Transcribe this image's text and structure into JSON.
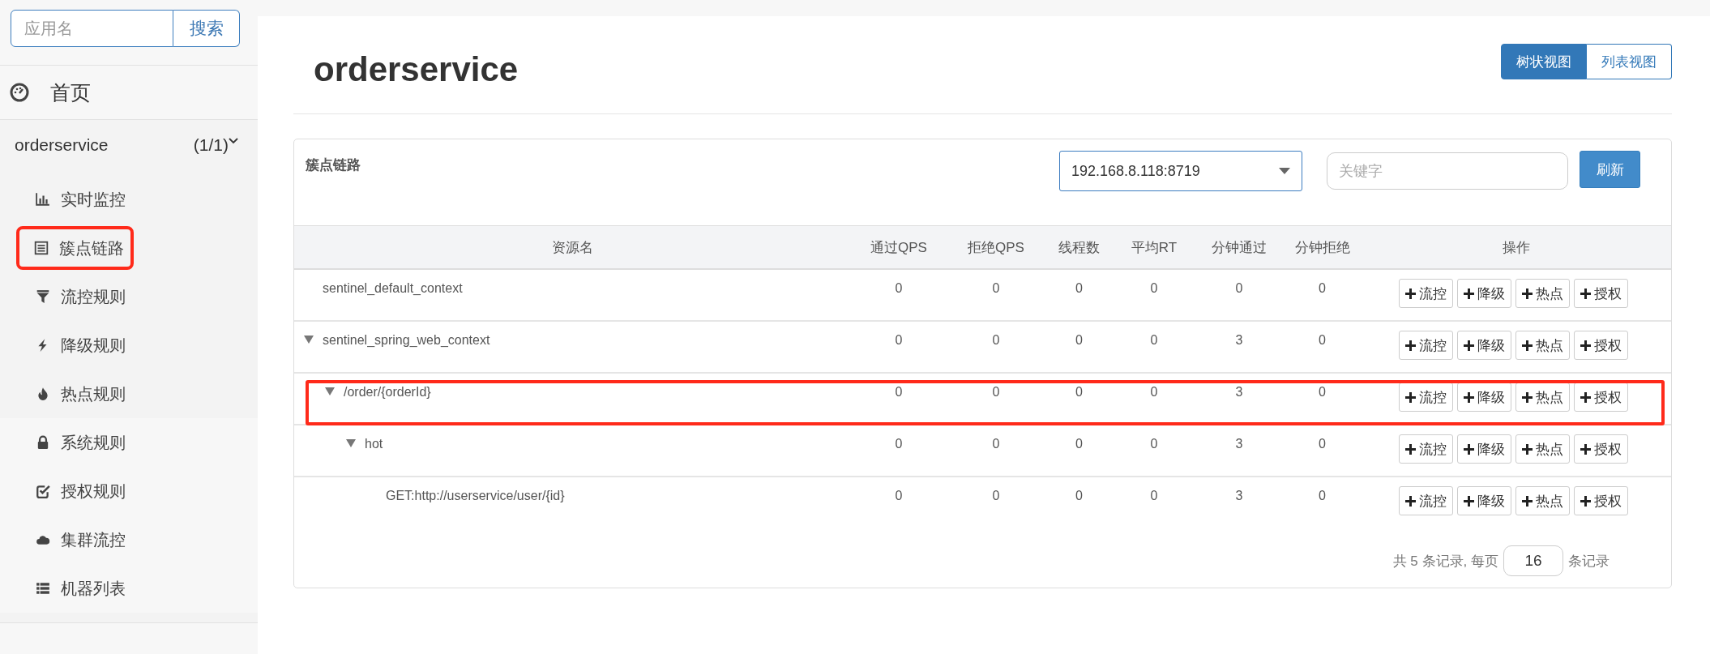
{
  "sidebar": {
    "search": {
      "placeholder": "应用名",
      "button": "搜索"
    },
    "home": {
      "label": "首页"
    },
    "app": {
      "name": "orderservice",
      "count": "(1/1)",
      "expanded": true,
      "items": [
        {
          "label": "实时监控",
          "highlighted": false
        },
        {
          "label": "簇点链路",
          "highlighted": true
        },
        {
          "label": "流控规则",
          "highlighted": false
        },
        {
          "label": "降级规则",
          "highlighted": false
        },
        {
          "label": "热点规则",
          "highlighted": false
        },
        {
          "label": "系统规则",
          "highlighted": false
        },
        {
          "label": "授权规则",
          "highlighted": false
        },
        {
          "label": "集群流控",
          "highlighted": false
        },
        {
          "label": "机器列表",
          "highlighted": false
        }
      ]
    }
  },
  "page": {
    "title": "orderservice",
    "views": [
      {
        "label": "树状视图",
        "selected": true
      },
      {
        "label": "列表视图",
        "selected": false
      }
    ]
  },
  "panel": {
    "title": "簇点链路",
    "machine": "192.168.8.118:8719",
    "keyword": {
      "placeholder": "关键字"
    },
    "refresh": "刷新",
    "table": {
      "columns": [
        "资源名",
        "通过QPS",
        "拒绝QPS",
        "线程数",
        "平均RT",
        "分钟通过",
        "分钟拒绝",
        "操作"
      ],
      "rows": [
        {
          "name": "sentinel_default_context",
          "values": [
            "0",
            "0",
            "0",
            "0",
            "0",
            "0"
          ],
          "actions": [
            "流控",
            "降级",
            "热点",
            "授权"
          ],
          "highlighted": false
        },
        {
          "name": "sentinel_spring_web_context",
          "values": [
            "0",
            "0",
            "0",
            "0",
            "3",
            "0"
          ],
          "actions": [
            "流控",
            "降级",
            "热点",
            "授权"
          ],
          "highlighted": false,
          "expanded": true,
          "children": [
            {
              "name": "/order/{orderId}",
              "values": [
                "0",
                "0",
                "0",
                "0",
                "3",
                "0"
              ],
              "actions": [
                "流控",
                "降级",
                "热点",
                "授权"
              ],
              "highlighted": true,
              "expanded": true,
              "children": [
                {
                  "name": "hot",
                  "values": [
                    "0",
                    "0",
                    "0",
                    "0",
                    "3",
                    "0"
                  ],
                  "actions": [
                    "流控",
                    "降级",
                    "热点",
                    "授权"
                  ],
                  "highlighted": false,
                  "expanded": true,
                  "children": [
                    {
                      "name": "GET:http://userservice/user/{id}",
                      "values": [
                        "0",
                        "0",
                        "0",
                        "0",
                        "3",
                        "0"
                      ],
                      "actions": [
                        "流控",
                        "降级",
                        "热点",
                        "授权"
                      ],
                      "highlighted": false
                    }
                  ]
                }
              ]
            }
          ]
        }
      ]
    },
    "pagination": {
      "prefix": "共 5 条记录, 每页",
      "page_size": "16",
      "suffix": "条记录"
    }
  }
}
